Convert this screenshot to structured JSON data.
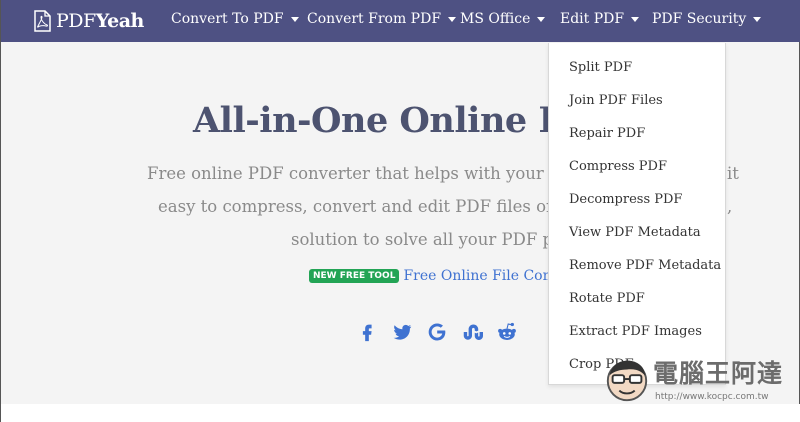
{
  "brand": {
    "part1": "PDF",
    "part2": "Yeah",
    "icon": "pdf-file-icon"
  },
  "nav": {
    "items": [
      {
        "label": "Convert To PDF"
      },
      {
        "label": "Convert From PDF"
      },
      {
        "label": "MS Office"
      },
      {
        "label": "Edit PDF"
      },
      {
        "label": "PDF Security"
      }
    ]
  },
  "hero": {
    "title": "All-in-One Online PDF",
    "lines": [
      "Free online PDF converter that helps with your every",
      "it",
      "easy to compress, convert and edit PDF files online",
      ",",
      "solution to solve all your PDF prob"
    ]
  },
  "tool": {
    "badge": "NEW FREE TOOL",
    "link": "Free Online File Compre"
  },
  "socials": [
    "facebook-icon",
    "twitter-icon",
    "google-icon",
    "stumbleupon-icon",
    "reddit-icon"
  ],
  "dropdown": {
    "items": [
      {
        "label": "Split PDF"
      },
      {
        "label": "Join PDF Files"
      },
      {
        "label": "Repair PDF"
      },
      {
        "label": "Compress PDF"
      },
      {
        "label": "Decompress PDF"
      },
      {
        "label": "View PDF Metadata"
      },
      {
        "label": "Remove PDF Metadata"
      },
      {
        "label": "Rotate PDF"
      },
      {
        "label": "Extract PDF Images"
      },
      {
        "label": "Crop PDF"
      }
    ]
  },
  "watermark": {
    "text": "電腦王阿達",
    "url": "http://www.kocpc.com.tw"
  },
  "colors": {
    "navbar": "#4e5183",
    "accent": "#3f72d1",
    "badge": "#23a455",
    "title": "#4d5370"
  }
}
